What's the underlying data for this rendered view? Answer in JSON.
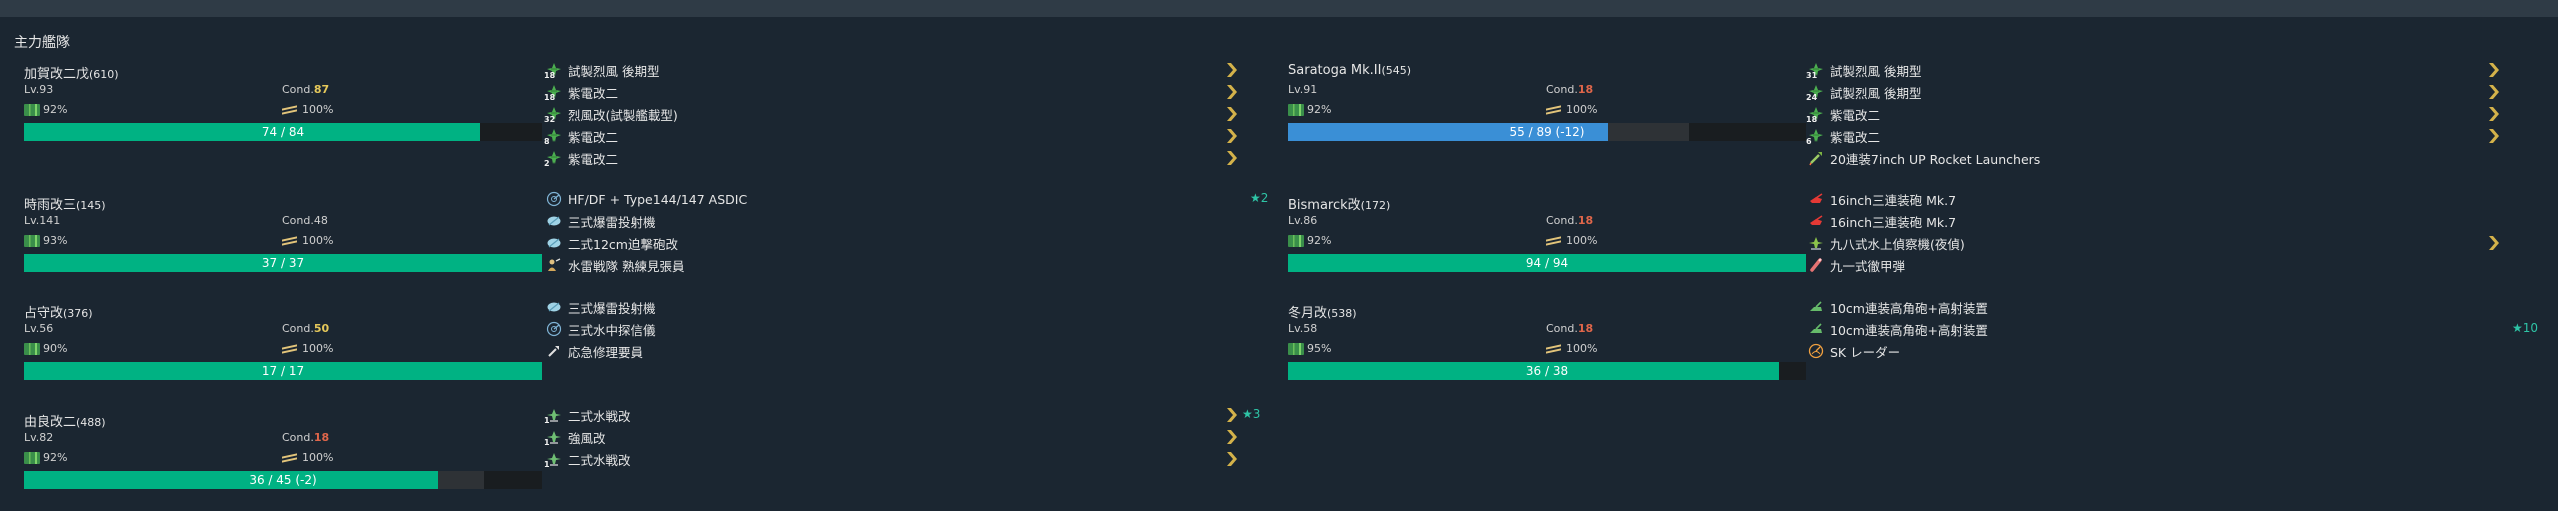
{
  "fleet": {
    "title": "主力艦隊"
  },
  "labels": {
    "lv": "Lv.",
    "cond": "Cond."
  },
  "colors": {
    "hp_green": "#00b283",
    "hp_blue": "#3a8fd6",
    "cond_yellow": "#e5c85a",
    "cond_red": "#e0664a",
    "improve": "#2ec4a6"
  },
  "ships": [
    {
      "name": "加賀改二戊",
      "id": "(610)",
      "lv": "93",
      "cond": "87",
      "cond_color": "yellow",
      "fuel": "92%",
      "ammo": "100%",
      "hp_text": "74 / 84",
      "hp_now": 74,
      "hp_max": 84,
      "hp_damage": 0,
      "hp_color": "green",
      "equips": [
        {
          "name": "試製烈風 後期型",
          "icon": "fighter-icon",
          "slot": "18",
          "prof": true
        },
        {
          "name": "紫電改二",
          "icon": "fighter-icon",
          "slot": "18",
          "prof": true
        },
        {
          "name": "烈風改(試製艦載型)",
          "icon": "fighter-icon",
          "slot": "32",
          "prof": true
        },
        {
          "name": "紫電改二",
          "icon": "fighter-icon",
          "slot": "8",
          "prof": true
        },
        {
          "name": "紫電改二",
          "icon": "fighter-icon",
          "slot": "2",
          "prof": true
        }
      ]
    },
    {
      "name": "時雨改三",
      "id": "(145)",
      "lv": "141",
      "cond": "48",
      "cond_color": "plain",
      "fuel": "93%",
      "ammo": "100%",
      "hp_text": "37 / 37",
      "hp_now": 37,
      "hp_max": 37,
      "hp_damage": 0,
      "hp_color": "green",
      "equips": [
        {
          "name": "HF/DF + Type144/147 ASDIC",
          "icon": "sonar-icon",
          "improve": "★2"
        },
        {
          "name": "三式爆雷投射機",
          "icon": "depth-charge-icon"
        },
        {
          "name": "二式12cm迫撃砲改",
          "icon": "depth-charge-icon"
        },
        {
          "name": "水雷戦隊 熟練見張員",
          "icon": "lookout-icon"
        }
      ]
    },
    {
      "name": "占守改",
      "id": "(376)",
      "lv": "56",
      "cond": "50",
      "cond_color": "yellow",
      "fuel": "90%",
      "ammo": "100%",
      "hp_text": "17 / 17",
      "hp_now": 17,
      "hp_max": 17,
      "hp_damage": 0,
      "hp_color": "green",
      "equips": [
        {
          "name": "三式爆雷投射機",
          "icon": "depth-charge-icon"
        },
        {
          "name": "三式水中探信儀",
          "icon": "sonar-icon"
        },
        {
          "name": "応急修理要員",
          "icon": "repair-icon"
        }
      ]
    },
    {
      "name": "由良改二",
      "id": "(488)",
      "lv": "82",
      "cond": "18",
      "cond_color": "red",
      "fuel": "92%",
      "ammo": "100%",
      "hp_text": "36 / 45 (-2)",
      "hp_now": 36,
      "hp_max": 45,
      "hp_damage": 2,
      "hp_color": "green",
      "equips": [
        {
          "name": "二式水戦改",
          "icon": "seaplane-fighter-icon",
          "slot": "1",
          "prof": true,
          "improve": "★3"
        },
        {
          "name": "強風改",
          "icon": "seaplane-fighter-icon",
          "slot": "1",
          "prof": true
        },
        {
          "name": "二式水戦改",
          "icon": "seaplane-fighter-icon",
          "slot": "1",
          "prof": true
        }
      ]
    },
    {
      "name": "Saratoga Mk.II",
      "id": "(545)",
      "lv": "91",
      "cond": "18",
      "cond_color": "red",
      "fuel": "92%",
      "ammo": "100%",
      "hp_text": "55 / 89 (-12)",
      "hp_now": 55,
      "hp_max": 89,
      "hp_damage": 12,
      "hp_color": "blue",
      "equips": [
        {
          "name": "試製烈風 後期型",
          "icon": "fighter-icon",
          "slot": "31",
          "prof": true
        },
        {
          "name": "試製烈風 後期型",
          "icon": "fighter-icon",
          "slot": "24",
          "prof": true
        },
        {
          "name": "紫電改二",
          "icon": "fighter-icon",
          "slot": "18",
          "prof": true
        },
        {
          "name": "紫電改二",
          "icon": "fighter-icon",
          "slot": "6",
          "prof": true
        },
        {
          "name": "20連装7inch UP Rocket Launchers",
          "icon": "rocket-icon"
        }
      ]
    },
    {
      "name": "Bismarck改",
      "id": "(172)",
      "lv": "86",
      "cond": "18",
      "cond_color": "red",
      "fuel": "92%",
      "ammo": "100%",
      "hp_text": "94 / 94",
      "hp_now": 94,
      "hp_max": 94,
      "hp_damage": 0,
      "hp_color": "green",
      "equips": [
        {
          "name": "16inch三連装砲 Mk.7",
          "icon": "main-gun-icon"
        },
        {
          "name": "16inch三連装砲 Mk.7",
          "icon": "main-gun-icon"
        },
        {
          "name": "九八式水上偵察機(夜偵)",
          "icon": "seaplane-recon-icon",
          "prof": true
        },
        {
          "name": "九一式徹甲弾",
          "icon": "ap-shell-icon"
        }
      ]
    },
    {
      "name": "冬月改",
      "id": "(538)",
      "lv": "58",
      "cond": "18",
      "cond_color": "red",
      "fuel": "95%",
      "ammo": "100%",
      "hp_text": "36 / 38",
      "hp_now": 36,
      "hp_max": 38,
      "hp_damage": 0,
      "hp_color": "green",
      "equips": [
        {
          "name": "10cm連装高角砲+高射装置",
          "icon": "aa-gun-icon"
        },
        {
          "name": "10cm連装高角砲+高射装置",
          "icon": "aa-gun-icon",
          "improve": "★10"
        },
        {
          "name": "SK レーダー",
          "icon": "radar-icon"
        }
      ]
    }
  ]
}
